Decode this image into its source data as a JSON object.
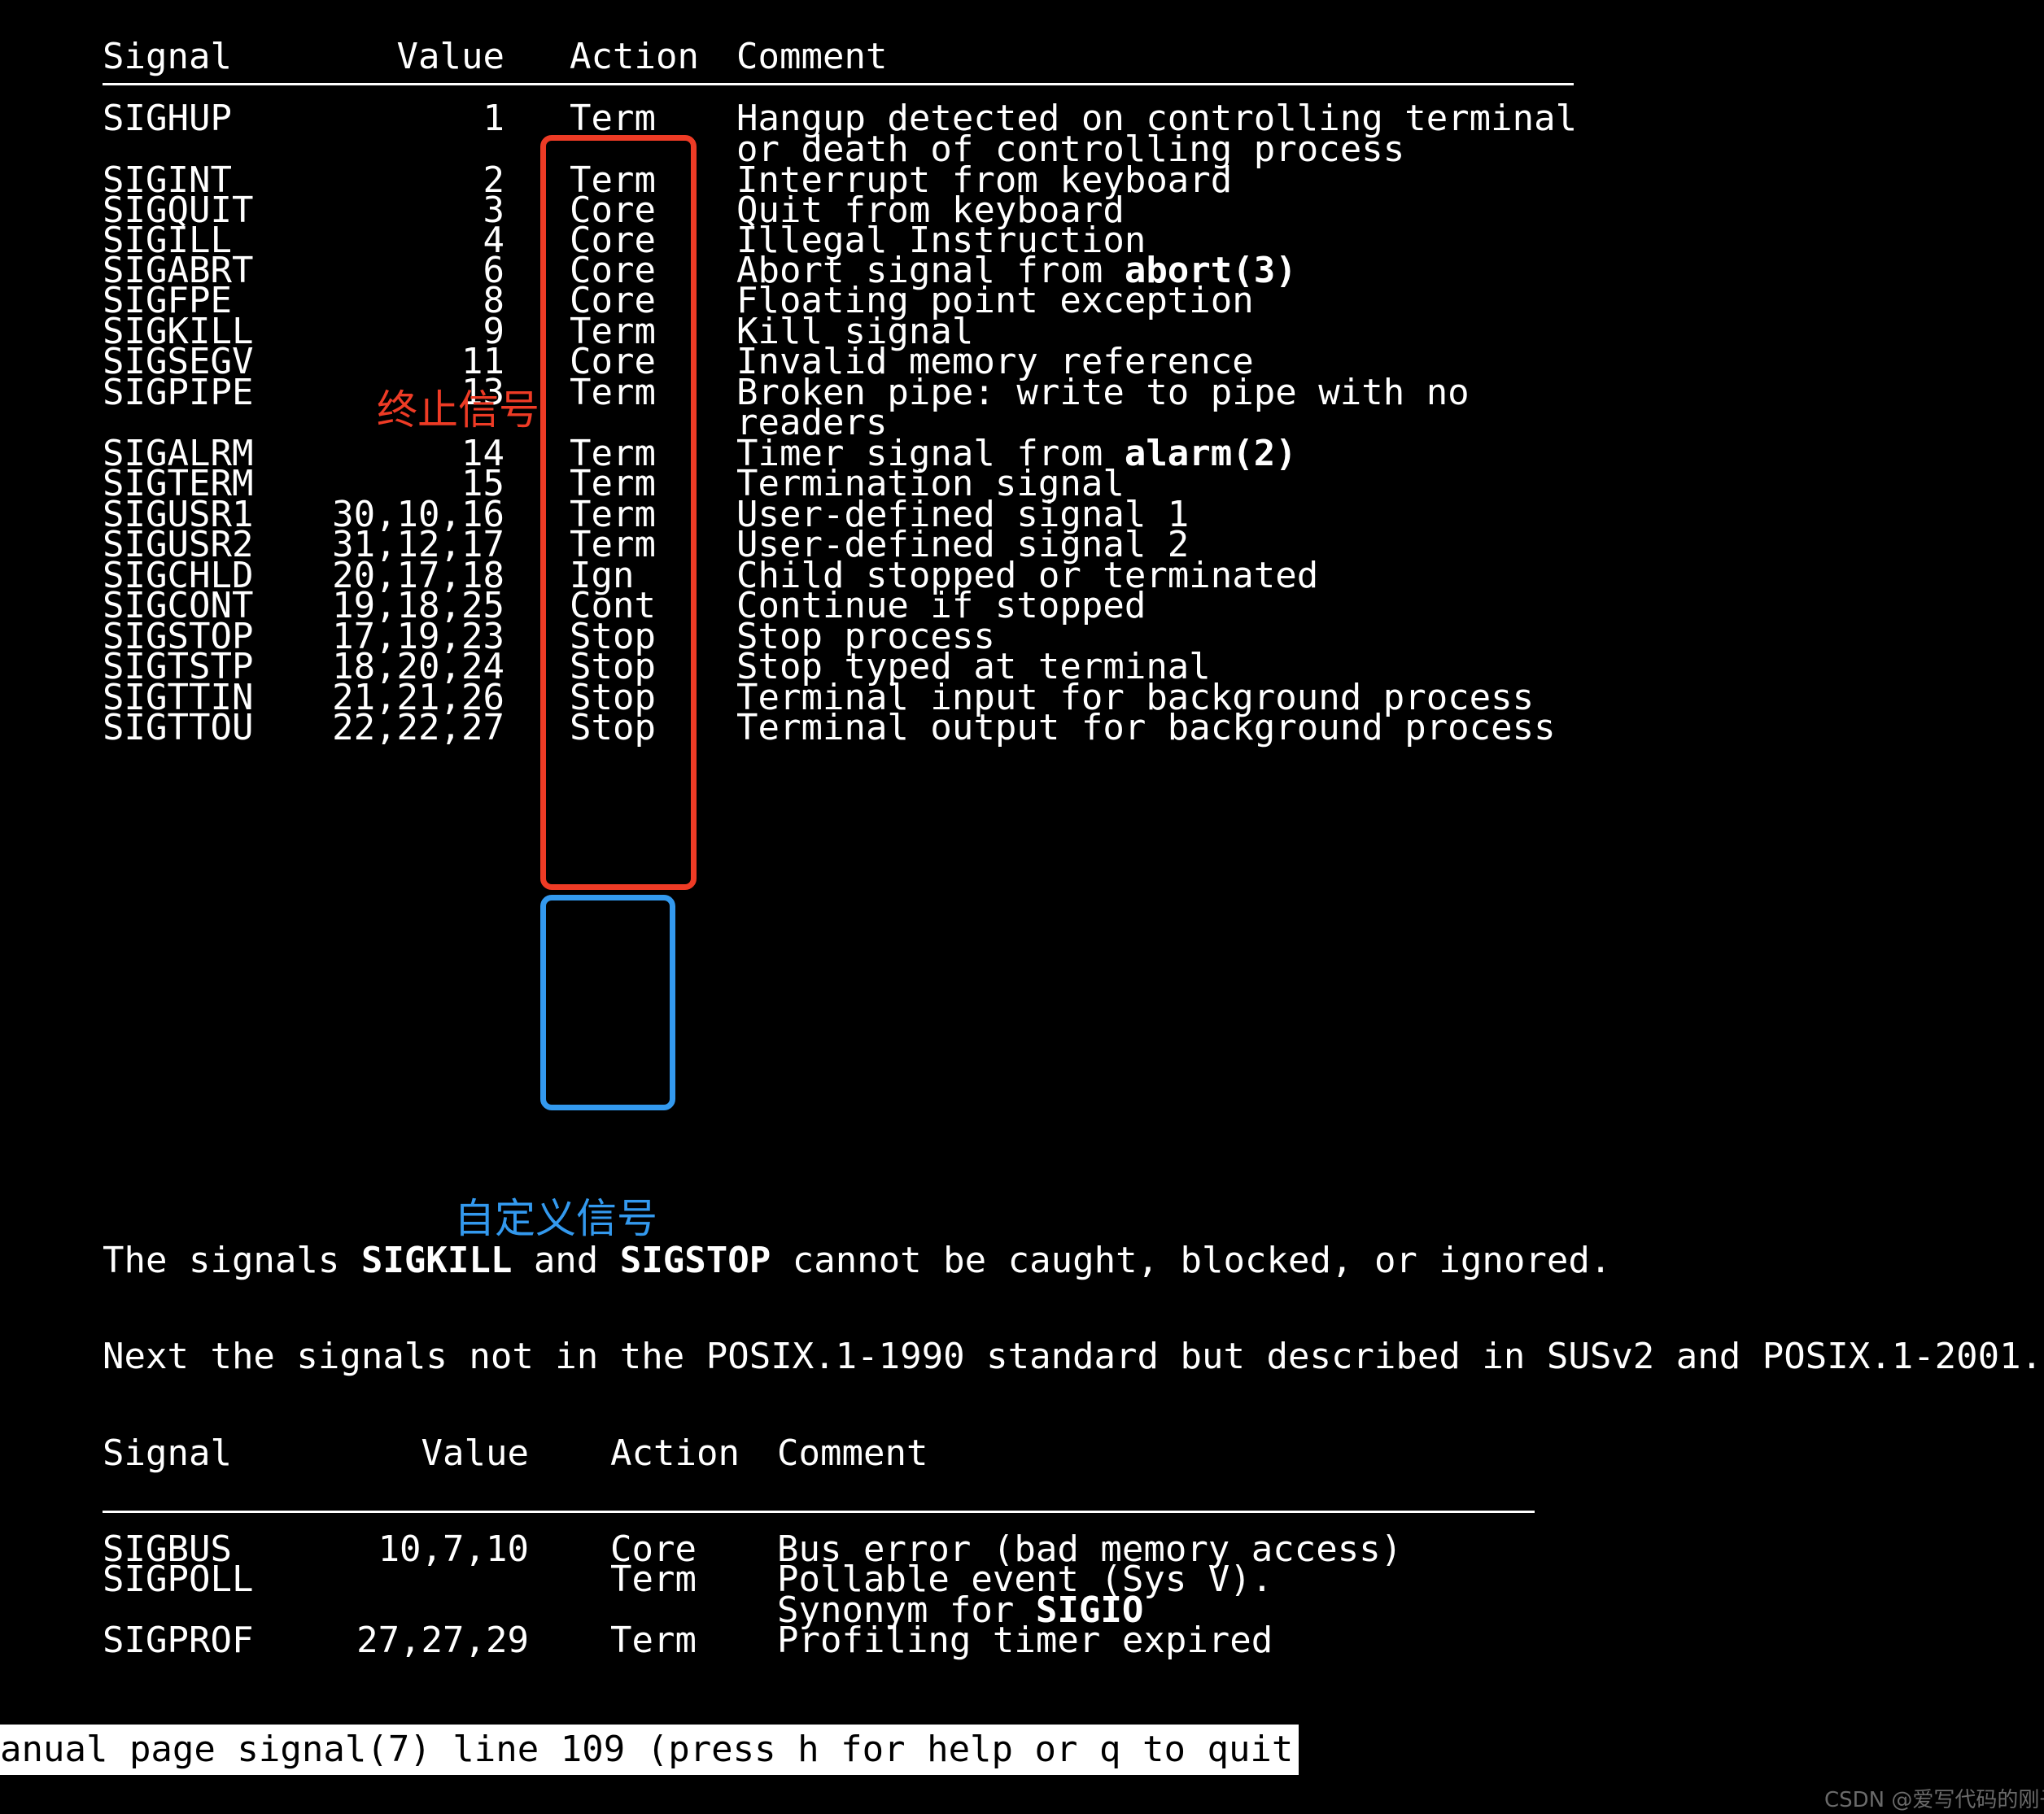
{
  "terminal": {
    "program": "man",
    "page": "signal(7)"
  },
  "table1": {
    "headers": {
      "signal": "Signal",
      "value": "Value",
      "action": "Action",
      "comment": "Comment"
    },
    "rows": [
      {
        "signal": "SIGHUP",
        "value": "1",
        "action": "Term",
        "comment": "Hangup detected on controlling terminal",
        "comment2": "or death of controlling process"
      },
      {
        "signal": "SIGINT",
        "value": "2",
        "action": "Term",
        "comment": "Interrupt from keyboard",
        "comment2": ""
      },
      {
        "signal": "SIGQUIT",
        "value": "3",
        "action": "Core",
        "comment": "Quit from keyboard",
        "comment2": ""
      },
      {
        "signal": "SIGILL",
        "value": "4",
        "action": "Core",
        "comment": "Illegal Instruction",
        "comment2": ""
      },
      {
        "signal": "SIGABRT",
        "value": "6",
        "action": "Core",
        "comment": "Abort signal from ",
        "comment_bold": "abort(3)",
        "comment2": ""
      },
      {
        "signal": "SIGFPE",
        "value": "8",
        "action": "Core",
        "comment": "Floating point exception",
        "comment2": ""
      },
      {
        "signal": "SIGKILL",
        "value": "9",
        "action": "Term",
        "comment": "Kill signal",
        "comment2": ""
      },
      {
        "signal": "SIGSEGV",
        "value": "11",
        "action": "Core",
        "comment": "Invalid memory reference",
        "comment2": ""
      },
      {
        "signal": "SIGPIPE",
        "value": "13",
        "action": "Term",
        "comment": "Broken pipe: write to pipe with no",
        "comment2": "readers"
      },
      {
        "signal": "SIGALRM",
        "value": "14",
        "action": "Term",
        "comment": "Timer signal from ",
        "comment_bold": "alarm(2)",
        "comment2": ""
      },
      {
        "signal": "SIGTERM",
        "value": "15",
        "action": "Term",
        "comment": "Termination signal",
        "comment2": ""
      },
      {
        "signal": "SIGUSR1",
        "value": "30,10,16",
        "action": "Term",
        "comment": "User-defined signal 1",
        "comment2": ""
      },
      {
        "signal": "SIGUSR2",
        "value": "31,12,17",
        "action": "Term",
        "comment": "User-defined signal 2",
        "comment2": ""
      },
      {
        "signal": "SIGCHLD",
        "value": "20,17,18",
        "action": "Ign",
        "comment": "Child stopped or terminated",
        "comment2": ""
      },
      {
        "signal": "SIGCONT",
        "value": "19,18,25",
        "action": "Cont",
        "comment": "Continue if stopped",
        "comment2": ""
      },
      {
        "signal": "SIGSTOP",
        "value": "17,19,23",
        "action": "Stop",
        "comment": "Stop process",
        "comment2": ""
      },
      {
        "signal": "SIGTSTP",
        "value": "18,20,24",
        "action": "Stop",
        "comment": "Stop typed at terminal",
        "comment2": ""
      },
      {
        "signal": "SIGTTIN",
        "value": "21,21,26",
        "action": "Stop",
        "comment": "Terminal input for background process",
        "comment2": ""
      },
      {
        "signal": "SIGTTOU",
        "value": "22,22,27",
        "action": "Stop",
        "comment": "Terminal output for background process",
        "comment2": ""
      }
    ]
  },
  "paragraph1": {
    "part1": "The signals ",
    "bold1": "SIGKILL",
    "part2": " and ",
    "bold2": "SIGSTOP",
    "part3": " cannot be caught, blocked, or ignored."
  },
  "paragraph2": {
    "text": "Next the signals not in the POSIX.1-1990 standard but described in SUSv2 and POSIX.1-2001."
  },
  "table2": {
    "headers": {
      "signal": "Signal",
      "value": "Value",
      "action": "Action",
      "comment": "Comment"
    },
    "rows": [
      {
        "signal": "SIGBUS",
        "value": "10,7,10",
        "action": "Core",
        "comment": "Bus error (bad memory access)",
        "comment2": ""
      },
      {
        "signal": "SIGPOLL",
        "value": "",
        "action": "Term",
        "comment": "Pollable event (Sys V).",
        "comment2": "Synonym for ",
        "comment2_bold": "SIGIO"
      },
      {
        "signal": "SIGPROF",
        "value": "27,27,29",
        "action": "Term",
        "comment": "Profiling timer expired",
        "comment2": ""
      }
    ]
  },
  "annotations": [
    {
      "name": "term-signals-box",
      "label": "终止信号",
      "color": "#ee3b25"
    },
    {
      "name": "custom-signals-box",
      "label": "自定义信号",
      "color": "#3399ee"
    }
  ],
  "statusbar": {
    "text": "anual page signal(7) line 109 (press h for help or q to quit)"
  },
  "watermark": {
    "text": "CSDN @爱写代码的刚子"
  }
}
